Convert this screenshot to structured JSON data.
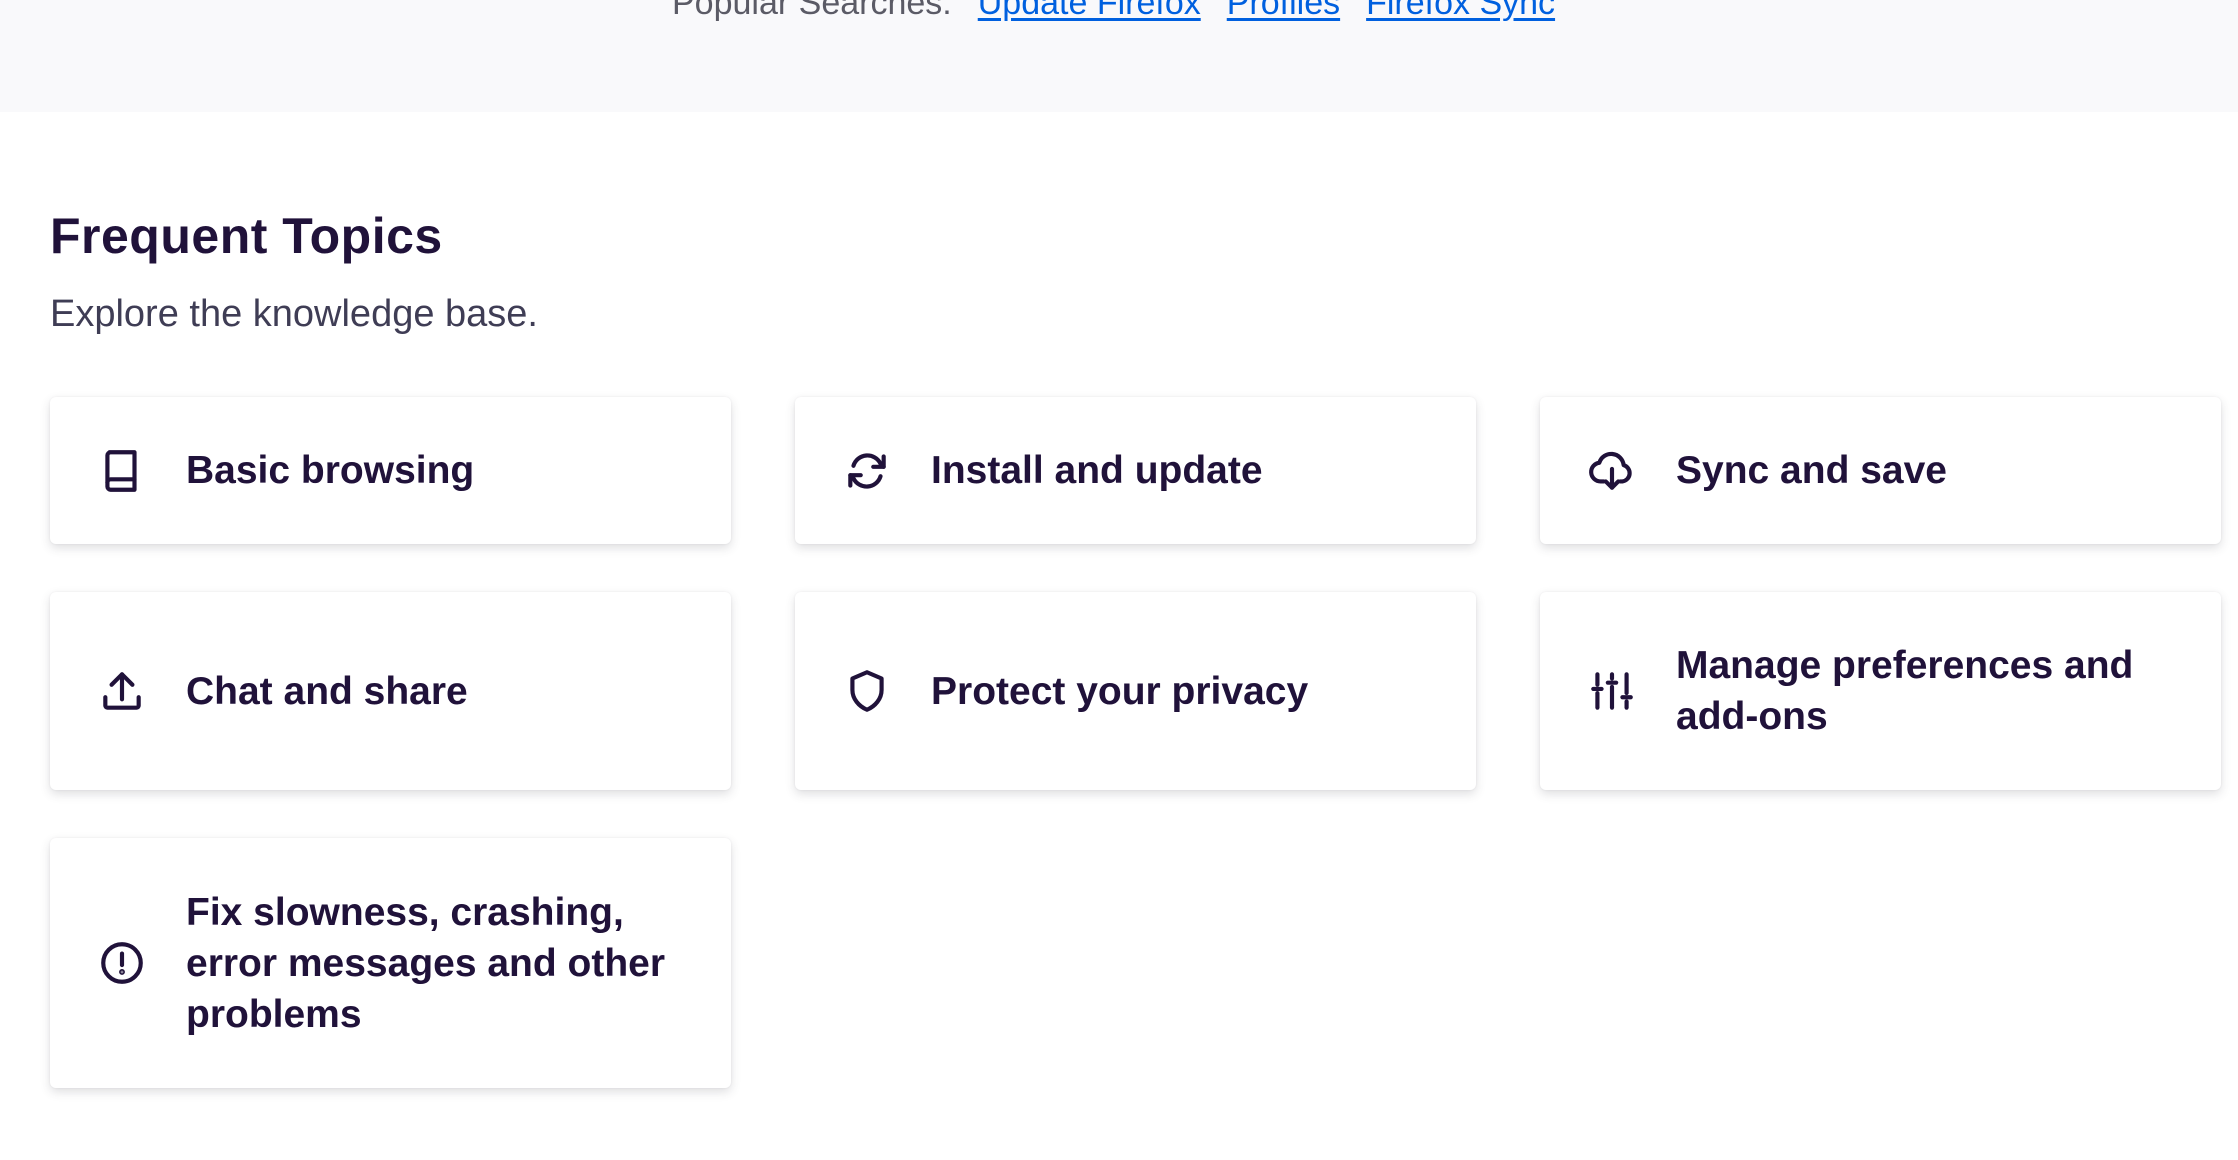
{
  "popular_searches": {
    "label": "Popular Searches:",
    "links": [
      "Update Firefox",
      "Profiles",
      "Firefox Sync"
    ]
  },
  "section": {
    "title": "Frequent Topics",
    "subtitle": "Explore the knowledge base."
  },
  "topics": [
    {
      "label": "Basic browsing",
      "icon": "book-icon"
    },
    {
      "label": "Install and update",
      "icon": "refresh-icon"
    },
    {
      "label": "Sync and save",
      "icon": "cloud-download-icon"
    },
    {
      "label": "Chat and share",
      "icon": "upload-icon"
    },
    {
      "label": "Protect your privacy",
      "icon": "shield-icon"
    },
    {
      "label": "Manage preferences and add-ons",
      "icon": "sliders-icon"
    },
    {
      "label": "Fix slowness, crashing, error messages and other problems",
      "icon": "alert-circle-icon"
    }
  ],
  "colors": {
    "text": "#20123a",
    "link": "#0060df",
    "band": "#f9f9fb"
  }
}
